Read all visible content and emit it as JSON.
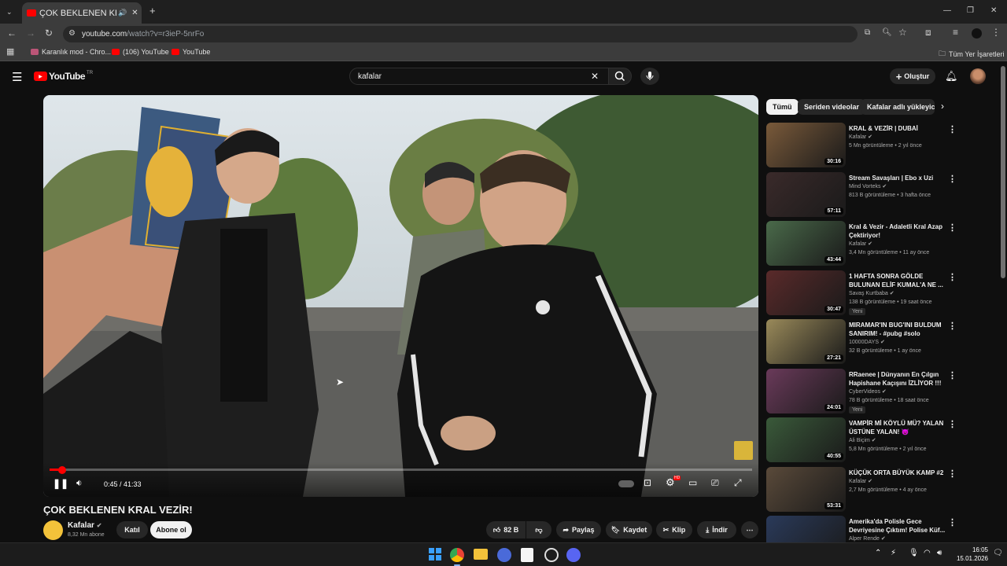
{
  "browser": {
    "tab_title": "ÇOK BEKLENEN KRAL VEZİR",
    "url_host": "youtube.com",
    "url_path": "/watch?v=r3ieP-5nrFo",
    "bookmarks": [
      "Karanlık mod - Chro...",
      "(106) YouTube",
      "YouTube"
    ],
    "other_bookmarks": "Tüm Yer İşaretleri"
  },
  "header": {
    "logo_text": "YouTube",
    "region": "TR",
    "search_value": "kafalar",
    "create_label": "Oluştur"
  },
  "player": {
    "time_current": "0:45",
    "time_total": "41:33",
    "time_display": "0:45 / 41:33",
    "progress": 0.018,
    "badge_new": "HD"
  },
  "video": {
    "title": "ÇOK BEKLENEN KRAL VEZİR!",
    "channel": "Kafalar",
    "subscribers": "8,32 Mn abone",
    "join_label": "Katıl",
    "subscribe_label": "Abone ol",
    "likes": "82 B",
    "share_label": "Paylaş",
    "save_label": "Kaydet",
    "clip_label": "Klip",
    "download_label": "İndir"
  },
  "chips": [
    "Tümü",
    "Seriden videolar",
    "Kafalar adlı yükleyici"
  ],
  "recommendations": [
    {
      "title": "KRAL & VEZİR | DUBAİ",
      "channel": "Kafalar",
      "meta": "5 Mn görüntüleme • 2 yıl önce",
      "duration": "30:16",
      "badge": "",
      "color": "#7a5a3a"
    },
    {
      "title": "Stream Savaşları | Ebo x Uzi",
      "channel": "Mind Vorteks",
      "meta": "813 B görüntüleme • 3 hafta önce",
      "duration": "57:11",
      "badge": "",
      "color": "#3a2a2a"
    },
    {
      "title": "Kral & Vezir - Adaletli Kral Azap Çektiriyor!",
      "channel": "Kafalar",
      "meta": "3,4 Mn görüntüleme • 11 ay önce",
      "duration": "43:44",
      "badge": "",
      "color": "#4a6a4a"
    },
    {
      "title": "1 HAFTA SONRA GÖLDE BULUNAN ELİF KUMAL'A NE ...",
      "channel": "Savaş Kurtbaba",
      "meta": "138 B görüntüleme • 19 saat önce",
      "duration": "30:47",
      "badge": "Yeni",
      "color": "#5a2a2a"
    },
    {
      "title": "MIRAMAR'IN BUG'INI BULDUM SANIRIM! - #pubg #solo",
      "channel": "10000DAYS",
      "meta": "32 B görüntüleme • 1 ay önce",
      "duration": "27:21",
      "badge": "",
      "color": "#9a8a5a"
    },
    {
      "title": "RRaenee | Dünyanın En Çılgın Hapishane Kaçışını İZLİYOR !!!",
      "channel": "CyberVideos",
      "meta": "78 B görüntüleme • 18 saat önce",
      "duration": "24:01",
      "badge": "Yeni",
      "color": "#6a3a5a"
    },
    {
      "title": "VAMPİR Mİ KÖYLÜ MÜ? YALAN ÜSTÜNE YALAN! 😈",
      "channel": "Ali Biçim",
      "meta": "5,8 Mn görüntüleme • 2 yıl önce",
      "duration": "40:55",
      "badge": "",
      "color": "#3a5a3a"
    },
    {
      "title": "KÜÇÜK ORTA BÜYÜK KAMP #2",
      "channel": "Kafalar",
      "meta": "2,7 Mn görüntüleme • 4 ay önce",
      "duration": "53:31",
      "badge": "",
      "color": "#5a4a3a"
    },
    {
      "title": "Amerika'da Polisle Gece Devriyesine Çıktım! Polise Küf...",
      "channel": "Alper Rende",
      "meta": "",
      "duration": "",
      "badge": "",
      "color": "#2a3a5a"
    }
  ],
  "taskbar": {
    "time": "16:05",
    "date": "15.01.2026"
  },
  "colors": {
    "accent": "#ff0000",
    "background": "#0f0f0f",
    "chip_active": "#f1f1f1"
  }
}
